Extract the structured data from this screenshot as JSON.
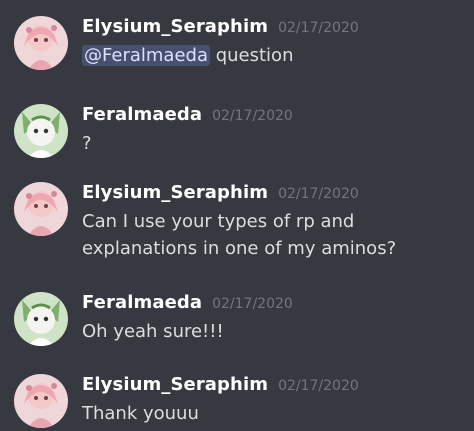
{
  "theme": {
    "background": "#36393f",
    "username_color": "#ffffff",
    "timestamp_color": "#72767d",
    "text_color": "#dcddde",
    "mention_bg": "#4e5c8b"
  },
  "messages": [
    {
      "author": "Elysium_Seraphim",
      "timestamp": "02/17/2020",
      "mention": "@Feralmaeda",
      "text": " question",
      "avatar": "pink-anime-avatar"
    },
    {
      "author": "Feralmaeda",
      "timestamp": "02/17/2020",
      "text": "?",
      "avatar": "green-white-creature-avatar"
    },
    {
      "author": "Elysium_Seraphim",
      "timestamp": "02/17/2020",
      "text": "Can I use your types of rp and explanations in one of my aminos?",
      "avatar": "pink-anime-avatar"
    },
    {
      "author": "Feralmaeda",
      "timestamp": "02/17/2020",
      "text": "Oh yeah sure!!!",
      "avatar": "green-white-creature-avatar"
    },
    {
      "author": "Elysium_Seraphim",
      "timestamp": "02/17/2020",
      "text": "Thank youuu",
      "avatar": "pink-anime-avatar"
    }
  ]
}
